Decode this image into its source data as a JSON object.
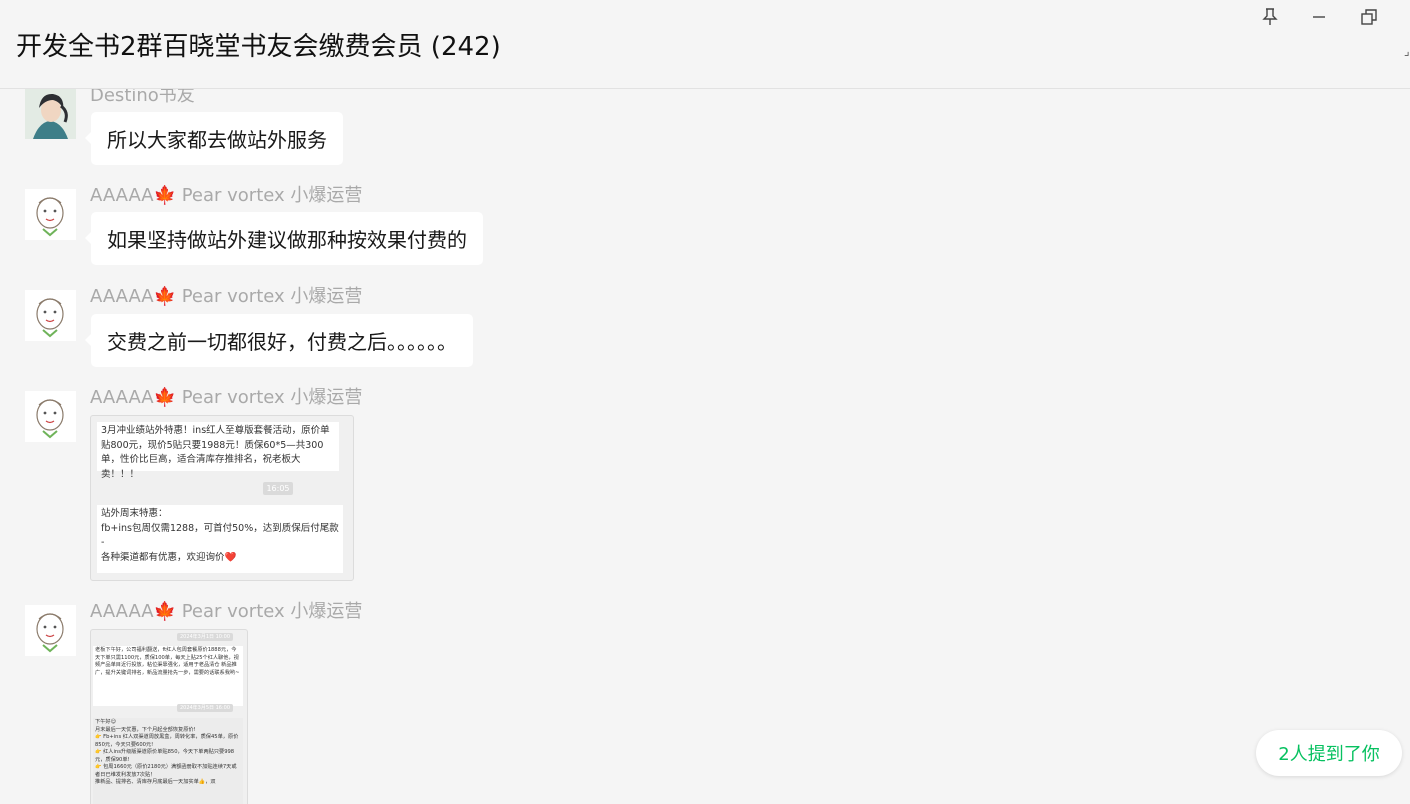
{
  "window": {
    "title": "开发全书2群百晓堂书友会缴费会员 (242)",
    "pin_icon": "pin-icon",
    "minimize_icon": "minimize-icon",
    "restore_icon": "restore-icon"
  },
  "messages": [
    {
      "sender": "Destino书友",
      "text": "所以大家都去做站外服务",
      "avatar": "illustrated-portrait"
    },
    {
      "sender": "AAAAA🍁 Pear vortex 小爆运营",
      "text": "如果坚持做站外建议做那种按效果付费的",
      "avatar": "doodle-face"
    },
    {
      "sender": "AAAAA🍁 Pear vortex 小爆运营",
      "text": "交费之前一切都很好，付费之后。。。。。。",
      "avatar": "doodle-face"
    },
    {
      "sender": "AAAAA🍁 Pear vortex 小爆运营",
      "avatar": "doodle-face",
      "image": {
        "block1": "3月冲业绩站外特惠！ins红人至尊版套餐活动，原价单贴800元，现价5贴只要1988元！质保60*5—共300单，性价比巨高，适合清库存推排名，祝老板大卖！！！",
        "timestamp": "16:05",
        "block2_line1": "站外周末特惠：",
        "block2_line2": "fb+ins包周仅需1288，可首付50%，达到质保后付尾款",
        "block2_line3": "-",
        "block2_line4": "各种渠道都有优惠，欢迎询价❤️"
      }
    },
    {
      "sender": "AAAAA🍁 Pear vortex 小爆运营",
      "avatar": "doodle-face",
      "image2": {
        "ts1": "2024年3月1日 10:00",
        "para1": "老板下午好，公司福利翻送，ft红人包周套餐原价1888元，今天下单只需1100元，质保100单，每天上贴25个红人聊他，视频产品单目近行投放，粘位渠靠强化，适用于老品清仓 新品推广，提升关键词排名，新品流量抢先一步，需要的话联系我哟~",
        "ts2": "2024年3月5日 16:00",
        "para2": "下午好😊\n月末最后一天优惠，下个月起全部恢复原价!\n👉 Fb+ins 红人双渠道周放黑盒，周转化率，质保45单，原价850元，今天只要600元!\n👉 红人ins升级版渠道原价单贴850，今天下单两贴只要998元，质保90单!\n👉 包周1660元（原价2180元）满额函册取不加贴连续7天或者日已维发利发放7次贴！\n推新品、提排名、清库存月底最后一天加实单👍，双"
      }
    }
  ],
  "mention_badge": "2人提到了你"
}
